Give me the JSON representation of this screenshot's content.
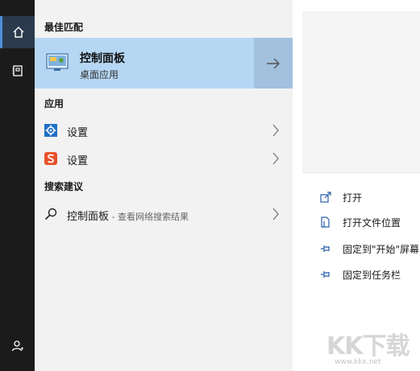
{
  "sections": {
    "best_match": "最佳匹配",
    "apps": "应用",
    "web_search": "搜索建议"
  },
  "best_match": {
    "title": "控制面板",
    "subtitle": "桌面应用"
  },
  "apps": [
    {
      "label": "设置",
      "icon": "gear-icon"
    },
    {
      "label": "设置",
      "icon": "sogou-s-icon"
    }
  ],
  "web_search": {
    "query": "控制面板",
    "hint": " - 查看网络搜索结果"
  },
  "actions": [
    {
      "label": "打开",
      "icon": "open-icon"
    },
    {
      "label": "打开文件位置",
      "icon": "file-location-icon"
    },
    {
      "label": "固定到\"开始\"屏幕",
      "icon": "pin-icon"
    },
    {
      "label": "固定到任务栏",
      "icon": "pin-icon"
    }
  ],
  "watermark": {
    "brand": "KK下载",
    "url": "www.kkx.net"
  },
  "colors": {
    "accent": "#4f8fd6",
    "selected": "#b6d7f4",
    "rail": "#1b1b1b"
  }
}
